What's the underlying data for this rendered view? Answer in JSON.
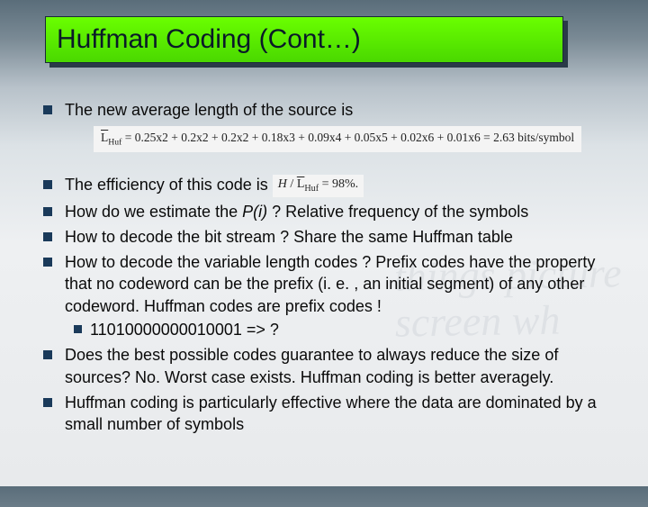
{
  "title": "Huffman Coding (Cont…)",
  "bg_words": "things\npicture\nscreen\nwh",
  "bullets": {
    "b1": "The new average length of the source is",
    "b2_pre": "The efficiency of this code is ",
    "b3_pre": "How do we estimate the ",
    "b3_ital": "P(i)",
    "b3_post": " ? Relative frequency of the symbols",
    "b4": "How to decode the bit stream ? Share the same Huffman table",
    "b5": "How to decode the variable length codes ? Prefix codes have the property that no codeword can be the prefix (i. e. , an initial segment) of any other codeword. Huffman codes are prefix codes !",
    "b5_sub": "11010000000010001 => ?",
    "b6": "Does the best possible codes guarantee to always reduce the size of sources? No. Worst case exists. Huffman coding is better averagely.",
    "b7": "Huffman coding is particularly effective where the data are dominated by a small number of symbols"
  },
  "formulas": {
    "avg_length": "L̄_Huf = 0.25×2 + 0.2×2 + 0.2×2 + 0.18×3 + 0.09×4 + 0.05×5 + 0.02×6 + 0.01×6 = 2.63 bits/symbol",
    "avg_length_lhs_sym": "L",
    "avg_length_lhs_sub": "Huf",
    "avg_length_rhs": " = 0.25x2 + 0.2x2 + 0.2x2 + 0.18x3 + 0.09x4 + 0.05x5 + 0.02x6 + 0.01x6 = 2.63 bits/symbol",
    "efficiency": "H / L̄_Huf = 98%",
    "eff_H": "H",
    "eff_slash": " / ",
    "eff_L": "L",
    "eff_sub": "Huf",
    "eff_rhs": " = 98%."
  }
}
